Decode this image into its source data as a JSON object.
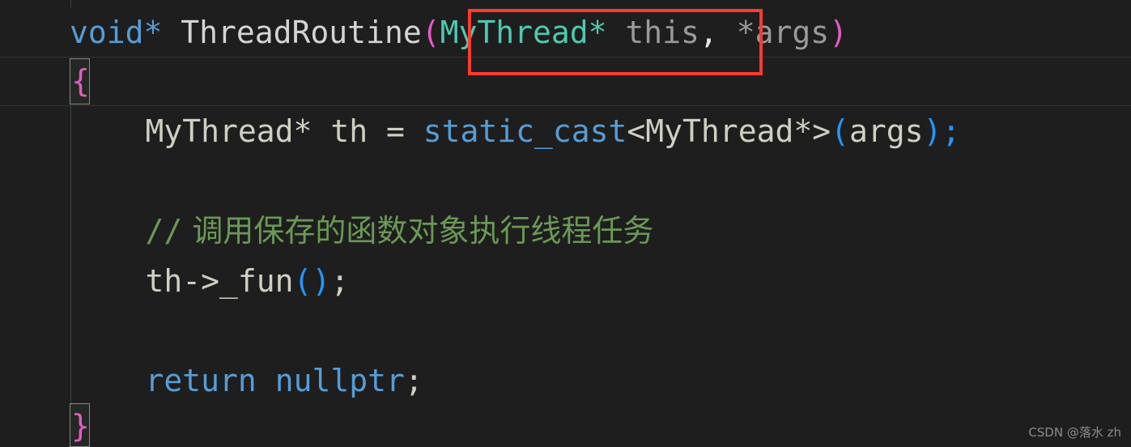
{
  "editor": {
    "theme": "vscode-dark",
    "background_color": "#1e1e1e",
    "font_size_px": 38,
    "colors": {
      "keyword": "#569cd6",
      "type": "#4ec9b0",
      "function": "#d4d4d4",
      "plain": "#cfcfc2",
      "param": "#9a9a96",
      "comment": "#6a9955",
      "bracket_pink": "#e45bc4",
      "bracket_blue": "#2596ff",
      "annotation_red": "#ff3b30"
    },
    "lines": [
      {
        "id": "line-signature",
        "tokens": {
          "return_type": "void*",
          "space1": " ",
          "function_name": "ThreadRoutine",
          "open_paren": "(",
          "param_type": "MyThread*",
          "space2": " ",
          "param_name": "this",
          "comma": ",",
          "space3": " ",
          "arg": "*args",
          "close_paren": ")"
        }
      },
      {
        "id": "line-open-brace",
        "tokens": {
          "brace": "{"
        }
      },
      {
        "id": "line-cast",
        "tokens": {
          "indent": "    ",
          "decl_type": "MyThread*",
          "space1": " ",
          "var_name": "th",
          "space2": " ",
          "equals": "=",
          "space3": " ",
          "cast_keyword": "static_cast",
          "template_args": "<MyThread*>",
          "open_paren": "(",
          "cast_arg": "args",
          "close_paren": ")",
          "semicolon": ";"
        }
      },
      {
        "id": "line-comment",
        "tokens": {
          "indent": "    ",
          "slashes": "//",
          "text": " 调用保存的函数对象执行线程任务"
        }
      },
      {
        "id": "line-call",
        "tokens": {
          "indent": "    ",
          "expr": "th->_fun",
          "parens": "()",
          "semicolon": ";"
        }
      },
      {
        "id": "line-return",
        "tokens": {
          "indent": "    ",
          "keyword": "return",
          "space": " ",
          "value": "nullptr",
          "semicolon": ";"
        }
      },
      {
        "id": "line-close-brace",
        "tokens": {
          "brace": "}"
        }
      }
    ]
  },
  "annotation": {
    "label": "red-highlight-box",
    "covers_text": "MyThread* this",
    "color": "#ff3b30"
  },
  "watermark": {
    "text": "CSDN @落水 zh"
  }
}
